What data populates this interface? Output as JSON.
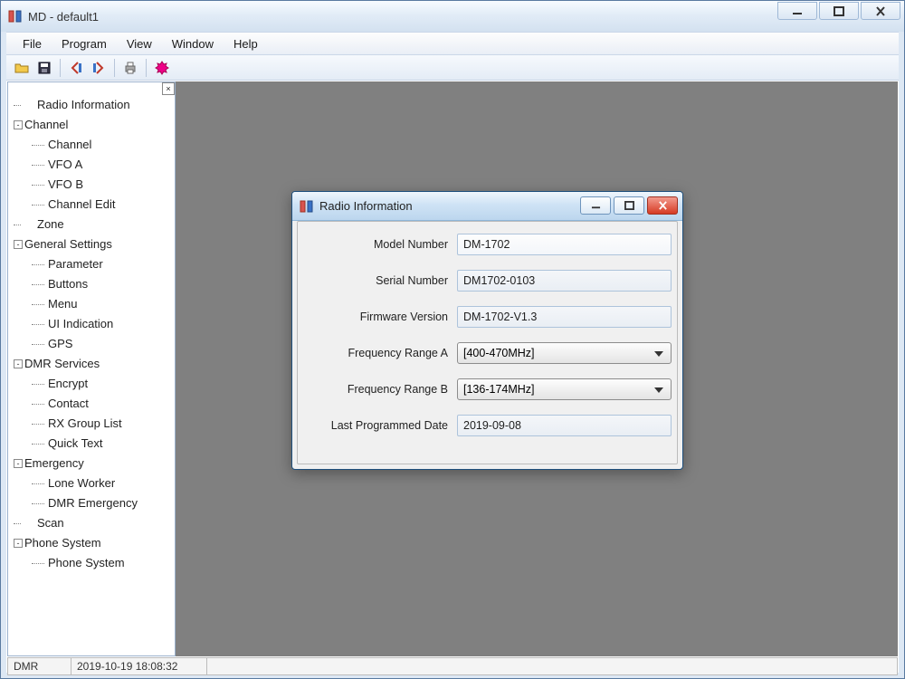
{
  "app": {
    "title": "MD - default1"
  },
  "menubar": [
    "File",
    "Program",
    "View",
    "Window",
    "Help"
  ],
  "toolbar_icons": [
    "open",
    "save",
    "read-radio",
    "write-radio",
    "print",
    "settings"
  ],
  "sidebar": {
    "items": [
      {
        "label": "Radio Information",
        "kind": "top"
      },
      {
        "label": "Channel",
        "kind": "group",
        "expanded": true
      },
      {
        "label": "Channel",
        "kind": "child"
      },
      {
        "label": "VFO A",
        "kind": "child"
      },
      {
        "label": "VFO B",
        "kind": "child"
      },
      {
        "label": "Channel Edit",
        "kind": "child"
      },
      {
        "label": "Zone",
        "kind": "top"
      },
      {
        "label": "General Settings",
        "kind": "group",
        "expanded": true
      },
      {
        "label": "Parameter",
        "kind": "child"
      },
      {
        "label": "Buttons",
        "kind": "child"
      },
      {
        "label": "Menu",
        "kind": "child"
      },
      {
        "label": "UI Indication",
        "kind": "child"
      },
      {
        "label": "GPS",
        "kind": "child"
      },
      {
        "label": "DMR Services",
        "kind": "group",
        "expanded": true
      },
      {
        "label": "Encrypt",
        "kind": "child"
      },
      {
        "label": "Contact",
        "kind": "child"
      },
      {
        "label": "RX Group List",
        "kind": "child"
      },
      {
        "label": "Quick Text",
        "kind": "child"
      },
      {
        "label": "Emergency",
        "kind": "group",
        "expanded": true
      },
      {
        "label": "Lone Worker",
        "kind": "child"
      },
      {
        "label": "DMR Emergency",
        "kind": "child"
      },
      {
        "label": "Scan",
        "kind": "top"
      },
      {
        "label": "Phone System",
        "kind": "group",
        "expanded": true
      },
      {
        "label": "Phone System",
        "kind": "child"
      }
    ]
  },
  "dialog": {
    "title": "Radio Information",
    "fields": {
      "model_label": "Model Number",
      "model_value": "DM-1702",
      "serial_label": "Serial Number",
      "serial_value": "DM1702-0103",
      "fw_label": "Firmware Version",
      "fw_value": "DM-1702-V1.3",
      "rangeA_label": "Frequency Range A",
      "rangeA_value": "[400-470MHz]",
      "rangeB_label": "Frequency Range B",
      "rangeB_value": "[136-174MHz]",
      "lastprog_label": "Last Programmed Date",
      "lastprog_value": "2019-09-08"
    }
  },
  "statusbar": {
    "mode": "DMR",
    "timestamp": "2019-10-19 18:08:32"
  }
}
